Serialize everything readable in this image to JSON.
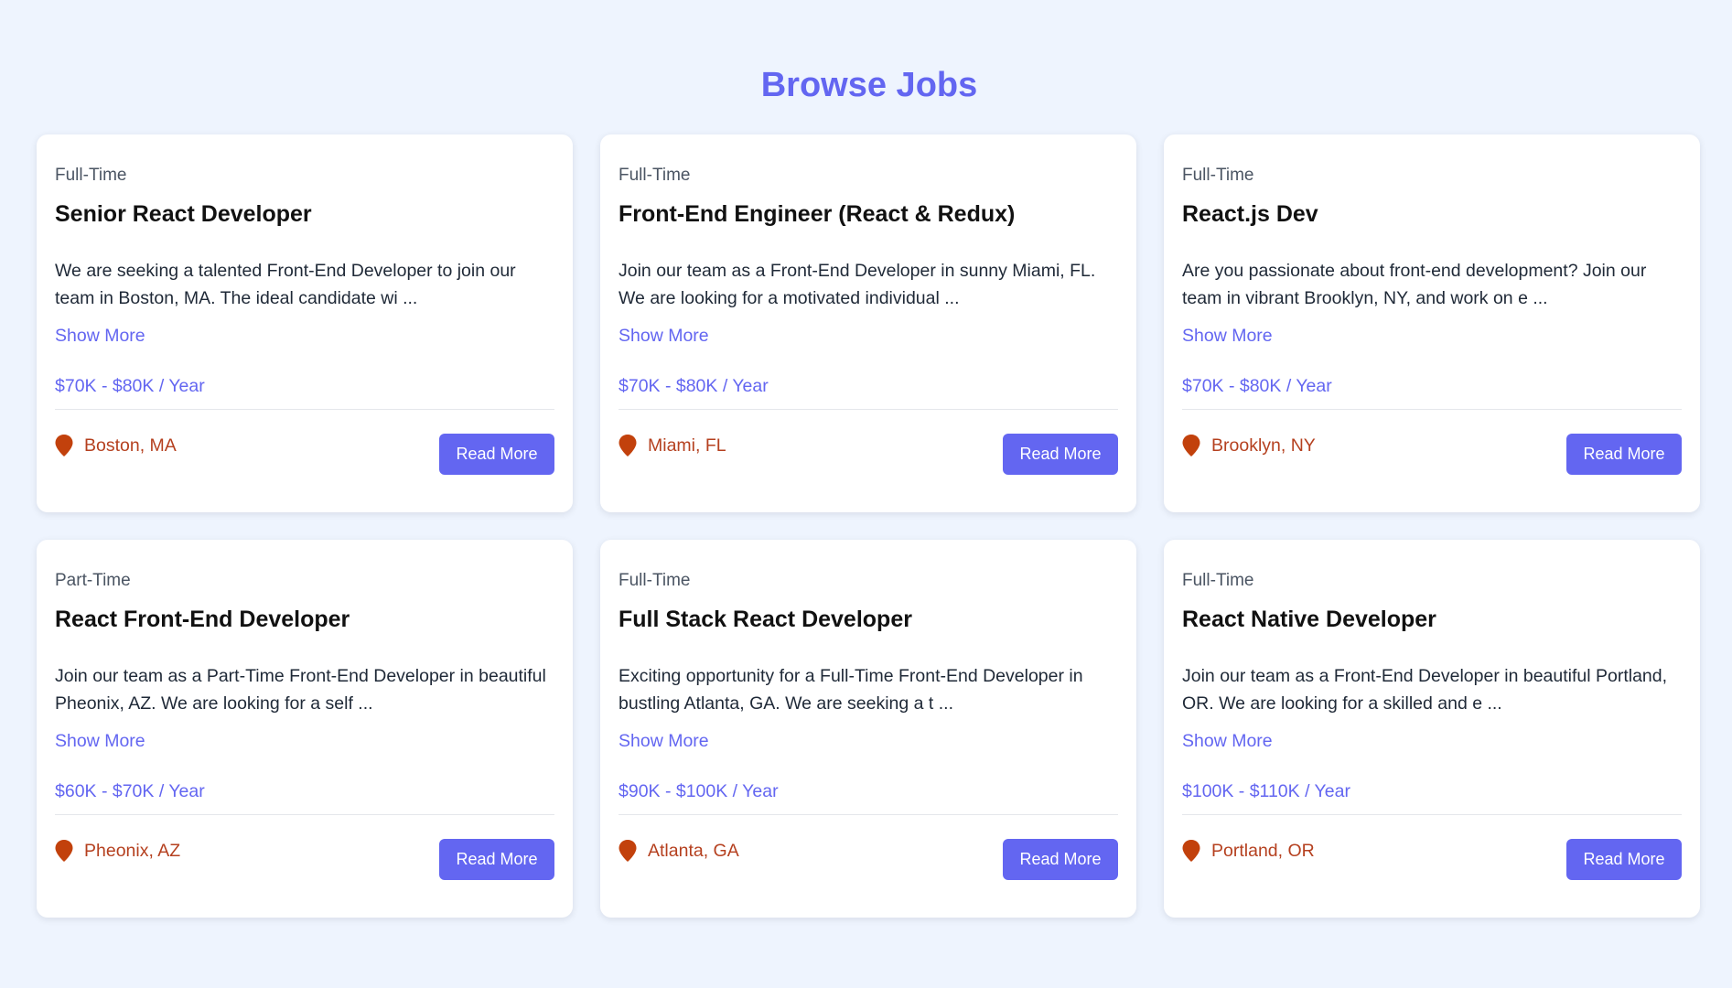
{
  "page": {
    "title": "Browse Jobs",
    "accent_color": "#6366f1",
    "location_color": "#b5401f",
    "background_color": "#eef4fe"
  },
  "jobs": [
    {
      "type": "Full-Time",
      "title": "Senior React Developer",
      "description": "We are seeking a talented Front-End Developer to join our team in Boston, MA. The ideal candidate wi ...",
      "show_more_label": "Show More",
      "salary": "$70K - $80K / Year",
      "location": "Boston, MA",
      "button_label": "Read More"
    },
    {
      "type": "Full-Time",
      "title": "Front-End Engineer (React & Redux)",
      "description": "Join our team as a Front-End Developer in sunny Miami, FL. We are looking for a motivated individual ...",
      "show_more_label": "Show More",
      "salary": "$70K - $80K / Year",
      "location": "Miami, FL",
      "button_label": "Read More"
    },
    {
      "type": "Full-Time",
      "title": "React.js Dev",
      "description": "Are you passionate about front-end development? Join our team in vibrant Brooklyn, NY, and work on e ...",
      "show_more_label": "Show More",
      "salary": "$70K - $80K / Year",
      "location": "Brooklyn, NY",
      "button_label": "Read More"
    },
    {
      "type": "Part-Time",
      "title": "React Front-End Developer",
      "description": "Join our team as a Part-Time Front-End Developer in beautiful Pheonix, AZ. We are looking for a self ...",
      "show_more_label": "Show More",
      "salary": "$60K - $70K / Year",
      "location": "Pheonix, AZ",
      "button_label": "Read More"
    },
    {
      "type": "Full-Time",
      "title": "Full Stack React Developer",
      "description": "Exciting opportunity for a Full-Time Front-End Developer in bustling Atlanta, GA. We are seeking a t ...",
      "show_more_label": "Show More",
      "salary": "$90K - $100K / Year",
      "location": "Atlanta, GA",
      "button_label": "Read More"
    },
    {
      "type": "Full-Time",
      "title": "React Native Developer",
      "description": "Join our team as a Front-End Developer in beautiful Portland, OR. We are looking for a skilled and e ...",
      "show_more_label": "Show More",
      "salary": "$100K - $110K / Year",
      "location": "Portland, OR",
      "button_label": "Read More"
    }
  ]
}
